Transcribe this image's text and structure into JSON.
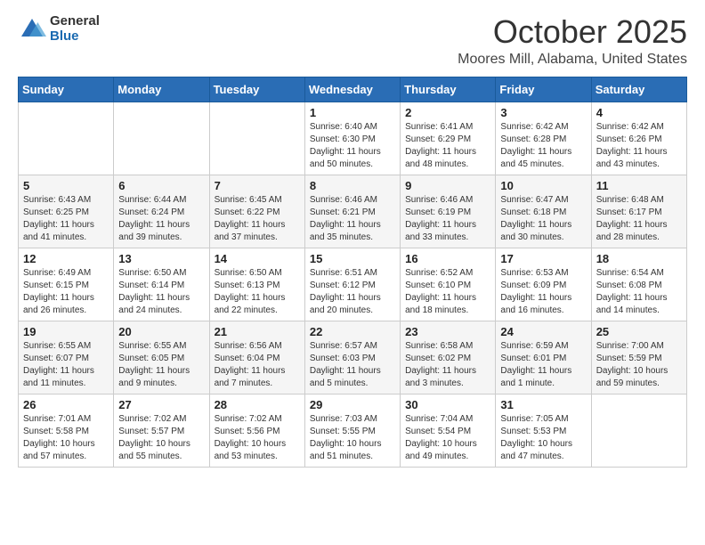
{
  "header": {
    "logo_general": "General",
    "logo_blue": "Blue",
    "month": "October 2025",
    "location": "Moores Mill, Alabama, United States"
  },
  "weekdays": [
    "Sunday",
    "Monday",
    "Tuesday",
    "Wednesday",
    "Thursday",
    "Friday",
    "Saturday"
  ],
  "weeks": [
    [
      {
        "day": "",
        "info": ""
      },
      {
        "day": "",
        "info": ""
      },
      {
        "day": "",
        "info": ""
      },
      {
        "day": "1",
        "info": "Sunrise: 6:40 AM\nSunset: 6:30 PM\nDaylight: 11 hours\nand 50 minutes."
      },
      {
        "day": "2",
        "info": "Sunrise: 6:41 AM\nSunset: 6:29 PM\nDaylight: 11 hours\nand 48 minutes."
      },
      {
        "day": "3",
        "info": "Sunrise: 6:42 AM\nSunset: 6:28 PM\nDaylight: 11 hours\nand 45 minutes."
      },
      {
        "day": "4",
        "info": "Sunrise: 6:42 AM\nSunset: 6:26 PM\nDaylight: 11 hours\nand 43 minutes."
      }
    ],
    [
      {
        "day": "5",
        "info": "Sunrise: 6:43 AM\nSunset: 6:25 PM\nDaylight: 11 hours\nand 41 minutes."
      },
      {
        "day": "6",
        "info": "Sunrise: 6:44 AM\nSunset: 6:24 PM\nDaylight: 11 hours\nand 39 minutes."
      },
      {
        "day": "7",
        "info": "Sunrise: 6:45 AM\nSunset: 6:22 PM\nDaylight: 11 hours\nand 37 minutes."
      },
      {
        "day": "8",
        "info": "Sunrise: 6:46 AM\nSunset: 6:21 PM\nDaylight: 11 hours\nand 35 minutes."
      },
      {
        "day": "9",
        "info": "Sunrise: 6:46 AM\nSunset: 6:19 PM\nDaylight: 11 hours\nand 33 minutes."
      },
      {
        "day": "10",
        "info": "Sunrise: 6:47 AM\nSunset: 6:18 PM\nDaylight: 11 hours\nand 30 minutes."
      },
      {
        "day": "11",
        "info": "Sunrise: 6:48 AM\nSunset: 6:17 PM\nDaylight: 11 hours\nand 28 minutes."
      }
    ],
    [
      {
        "day": "12",
        "info": "Sunrise: 6:49 AM\nSunset: 6:15 PM\nDaylight: 11 hours\nand 26 minutes."
      },
      {
        "day": "13",
        "info": "Sunrise: 6:50 AM\nSunset: 6:14 PM\nDaylight: 11 hours\nand 24 minutes."
      },
      {
        "day": "14",
        "info": "Sunrise: 6:50 AM\nSunset: 6:13 PM\nDaylight: 11 hours\nand 22 minutes."
      },
      {
        "day": "15",
        "info": "Sunrise: 6:51 AM\nSunset: 6:12 PM\nDaylight: 11 hours\nand 20 minutes."
      },
      {
        "day": "16",
        "info": "Sunrise: 6:52 AM\nSunset: 6:10 PM\nDaylight: 11 hours\nand 18 minutes."
      },
      {
        "day": "17",
        "info": "Sunrise: 6:53 AM\nSunset: 6:09 PM\nDaylight: 11 hours\nand 16 minutes."
      },
      {
        "day": "18",
        "info": "Sunrise: 6:54 AM\nSunset: 6:08 PM\nDaylight: 11 hours\nand 14 minutes."
      }
    ],
    [
      {
        "day": "19",
        "info": "Sunrise: 6:55 AM\nSunset: 6:07 PM\nDaylight: 11 hours\nand 11 minutes."
      },
      {
        "day": "20",
        "info": "Sunrise: 6:55 AM\nSunset: 6:05 PM\nDaylight: 11 hours\nand 9 minutes."
      },
      {
        "day": "21",
        "info": "Sunrise: 6:56 AM\nSunset: 6:04 PM\nDaylight: 11 hours\nand 7 minutes."
      },
      {
        "day": "22",
        "info": "Sunrise: 6:57 AM\nSunset: 6:03 PM\nDaylight: 11 hours\nand 5 minutes."
      },
      {
        "day": "23",
        "info": "Sunrise: 6:58 AM\nSunset: 6:02 PM\nDaylight: 11 hours\nand 3 minutes."
      },
      {
        "day": "24",
        "info": "Sunrise: 6:59 AM\nSunset: 6:01 PM\nDaylight: 11 hours\nand 1 minute."
      },
      {
        "day": "25",
        "info": "Sunrise: 7:00 AM\nSunset: 5:59 PM\nDaylight: 10 hours\nand 59 minutes."
      }
    ],
    [
      {
        "day": "26",
        "info": "Sunrise: 7:01 AM\nSunset: 5:58 PM\nDaylight: 10 hours\nand 57 minutes."
      },
      {
        "day": "27",
        "info": "Sunrise: 7:02 AM\nSunset: 5:57 PM\nDaylight: 10 hours\nand 55 minutes."
      },
      {
        "day": "28",
        "info": "Sunrise: 7:02 AM\nSunset: 5:56 PM\nDaylight: 10 hours\nand 53 minutes."
      },
      {
        "day": "29",
        "info": "Sunrise: 7:03 AM\nSunset: 5:55 PM\nDaylight: 10 hours\nand 51 minutes."
      },
      {
        "day": "30",
        "info": "Sunrise: 7:04 AM\nSunset: 5:54 PM\nDaylight: 10 hours\nand 49 minutes."
      },
      {
        "day": "31",
        "info": "Sunrise: 7:05 AM\nSunset: 5:53 PM\nDaylight: 10 hours\nand 47 minutes."
      },
      {
        "day": "",
        "info": ""
      }
    ]
  ]
}
